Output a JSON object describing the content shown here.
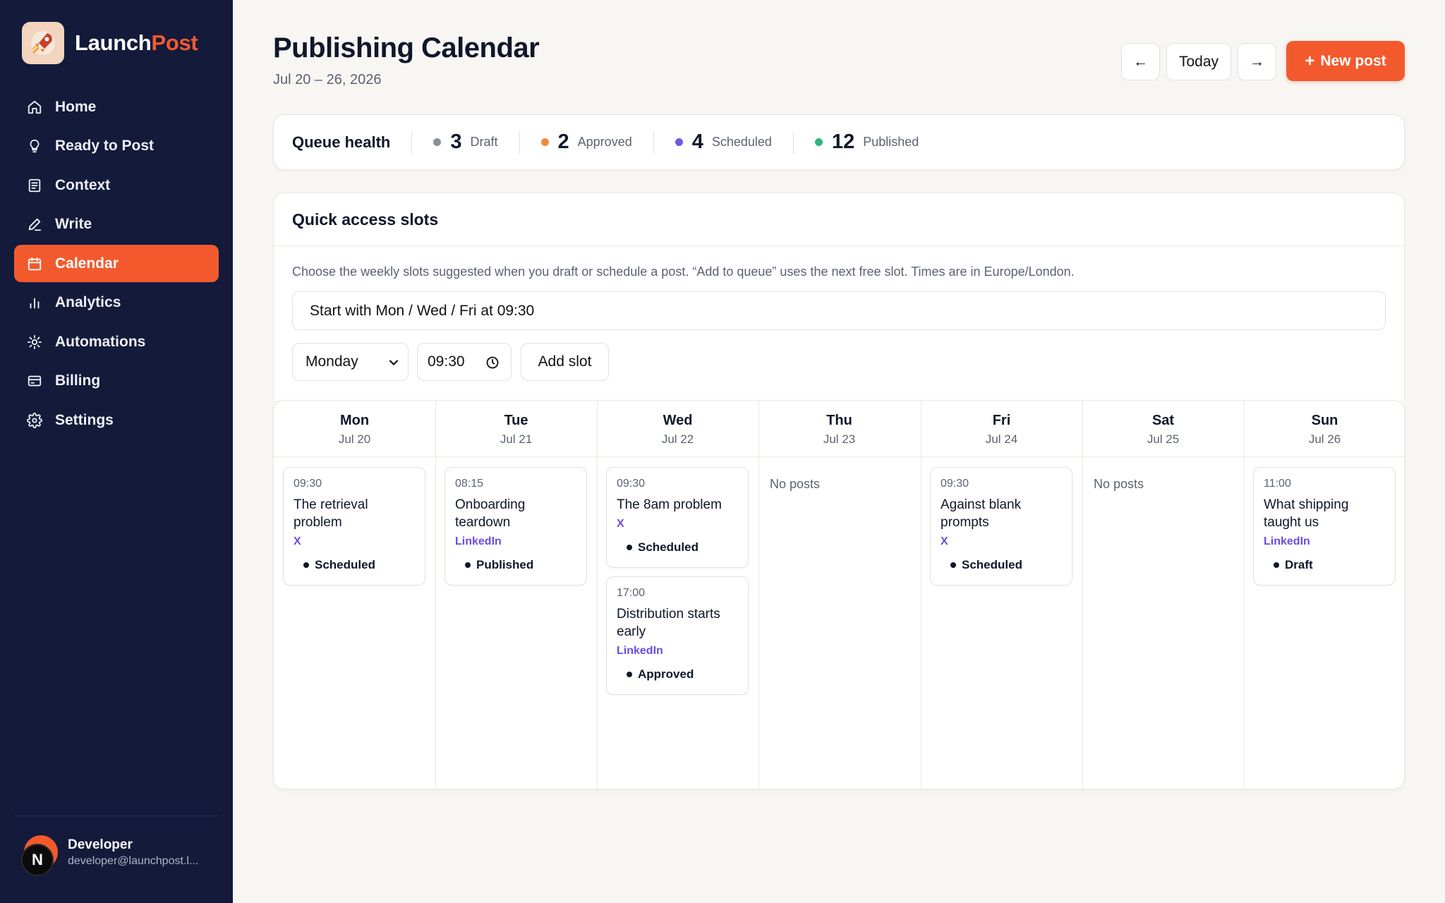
{
  "brand": {
    "name_a": "Launch",
    "name_b": "Post",
    "accent": "#f25a2e"
  },
  "sidebar": {
    "items": [
      {
        "label": "Home",
        "icon": "home-icon",
        "active": false
      },
      {
        "label": "Ready to Post",
        "icon": "lightbulb-icon",
        "active": false
      },
      {
        "label": "Context",
        "icon": "document-icon",
        "active": false
      },
      {
        "label": "Write",
        "icon": "pen-icon",
        "active": false
      },
      {
        "label": "Calendar",
        "icon": "calendar-icon",
        "active": true
      },
      {
        "label": "Analytics",
        "icon": "bar-chart-icon",
        "active": false
      },
      {
        "label": "Automations",
        "icon": "sun-icon",
        "active": false
      },
      {
        "label": "Billing",
        "icon": "credit-card-icon",
        "active": false
      },
      {
        "label": "Settings",
        "icon": "gear-icon",
        "active": false
      }
    ],
    "user": {
      "name": "Developer",
      "email": "developer@launchpost.l...",
      "avatar_letter": "N"
    }
  },
  "header": {
    "title": "Publishing Calendar",
    "date_range": "Jul 20 – 26, 2026",
    "prev_label": "←",
    "today_label": "Today",
    "next_label": "→",
    "new_post_label": "New post",
    "new_post_plus": "+"
  },
  "queue_health": {
    "title": "Queue health",
    "stats": [
      {
        "count": "3",
        "label": "Draft",
        "color": "#8a8f98"
      },
      {
        "count": "2",
        "label": "Approved",
        "color": "#ee8a3c"
      },
      {
        "count": "4",
        "label": "Scheduled",
        "color": "#6b5be6"
      },
      {
        "count": "12",
        "label": "Published",
        "color": "#33b37e"
      }
    ]
  },
  "quick_access": {
    "title": "Quick access slots",
    "description": "Choose the weekly slots suggested when you draft or schedule a post. “Add to queue” uses the next free slot. Times are in Europe/London.",
    "preset_label": "Start with Mon / Wed / Fri at 09:30",
    "day_value": "Monday",
    "time_value": "09:30",
    "add_slot_label": "Add slot"
  },
  "calendar": {
    "no_posts_label": "No posts",
    "days": [
      {
        "name": "Mon",
        "date": "Jul 20",
        "posts": [
          {
            "time": "09:30",
            "title": "The retrieval problem",
            "platform": "X",
            "status": "Scheduled"
          }
        ]
      },
      {
        "name": "Tue",
        "date": "Jul 21",
        "posts": [
          {
            "time": "08:15",
            "title": "Onboarding teardown",
            "platform": "LinkedIn",
            "status": "Published"
          }
        ]
      },
      {
        "name": "Wed",
        "date": "Jul 22",
        "posts": [
          {
            "time": "09:30",
            "title": "The 8am problem",
            "platform": "X",
            "status": "Scheduled"
          },
          {
            "time": "17:00",
            "title": "Distribution starts early",
            "platform": "LinkedIn",
            "status": "Approved"
          }
        ]
      },
      {
        "name": "Thu",
        "date": "Jul 23",
        "posts": []
      },
      {
        "name": "Fri",
        "date": "Jul 24",
        "posts": [
          {
            "time": "09:30",
            "title": "Against blank prompts",
            "platform": "X",
            "status": "Scheduled"
          }
        ]
      },
      {
        "name": "Sat",
        "date": "Jul 25",
        "posts": []
      },
      {
        "name": "Sun",
        "date": "Jul 26",
        "posts": [
          {
            "time": "11:00",
            "title": "What shipping taught us",
            "platform": "LinkedIn",
            "status": "Draft"
          }
        ]
      }
    ]
  }
}
